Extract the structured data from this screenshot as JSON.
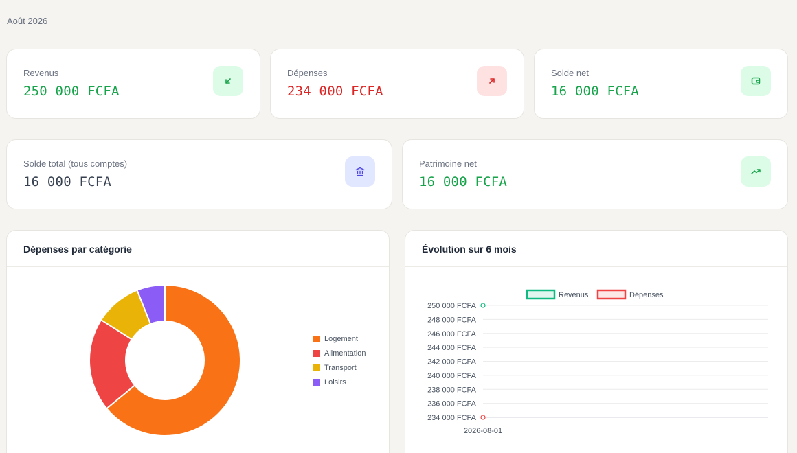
{
  "header": {
    "period": "Août 2026"
  },
  "cards": {
    "revenus": {
      "label": "Revenus",
      "value": "250 000 FCFA",
      "icon": "arrow-down-left-icon"
    },
    "depenses": {
      "label": "Dépenses",
      "value": "234 000 FCFA",
      "icon": "arrow-up-right-icon"
    },
    "solde_net": {
      "label": "Solde net",
      "value": "16 000 FCFA",
      "icon": "wallet-icon"
    },
    "solde_total": {
      "label": "Solde total (tous comptes)",
      "value": "16 000 FCFA",
      "icon": "bank-icon"
    },
    "patrimoine": {
      "label": "Patrimoine net",
      "value": "16 000 FCFA",
      "icon": "trending-up-icon"
    }
  },
  "colors": {
    "green": "#16a34a",
    "red": "#dc2626",
    "logement": "#f97316",
    "alimentation": "#ef4444",
    "transport": "#eab308",
    "loisirs": "#8b5cf6"
  },
  "panels": {
    "donut_title": "Dépenses par catégorie",
    "line_title": "Évolution sur 6 mois"
  },
  "chart_data": [
    {
      "type": "pie",
      "title": "Dépenses par catégorie",
      "categories": [
        "Logement",
        "Alimentation",
        "Transport",
        "Loisirs"
      ],
      "values": [
        64,
        20,
        10,
        6
      ],
      "legend": "right"
    },
    {
      "type": "line",
      "title": "Évolution sur 6 mois",
      "x": [
        "2026-08-01"
      ],
      "series": [
        {
          "name": "Revenus",
          "values": [
            250000
          ]
        },
        {
          "name": "Dépenses",
          "values": [
            234000
          ]
        }
      ],
      "ylim": [
        234000,
        250000
      ],
      "yticks": [
        "250 000 FCFA",
        "248 000 FCFA",
        "246 000 FCFA",
        "244 000 FCFA",
        "242 000 FCFA",
        "240 000 FCFA",
        "238 000 FCFA",
        "236 000 FCFA",
        "234 000 FCFA"
      ],
      "legend": "top",
      "grid": true
    }
  ]
}
